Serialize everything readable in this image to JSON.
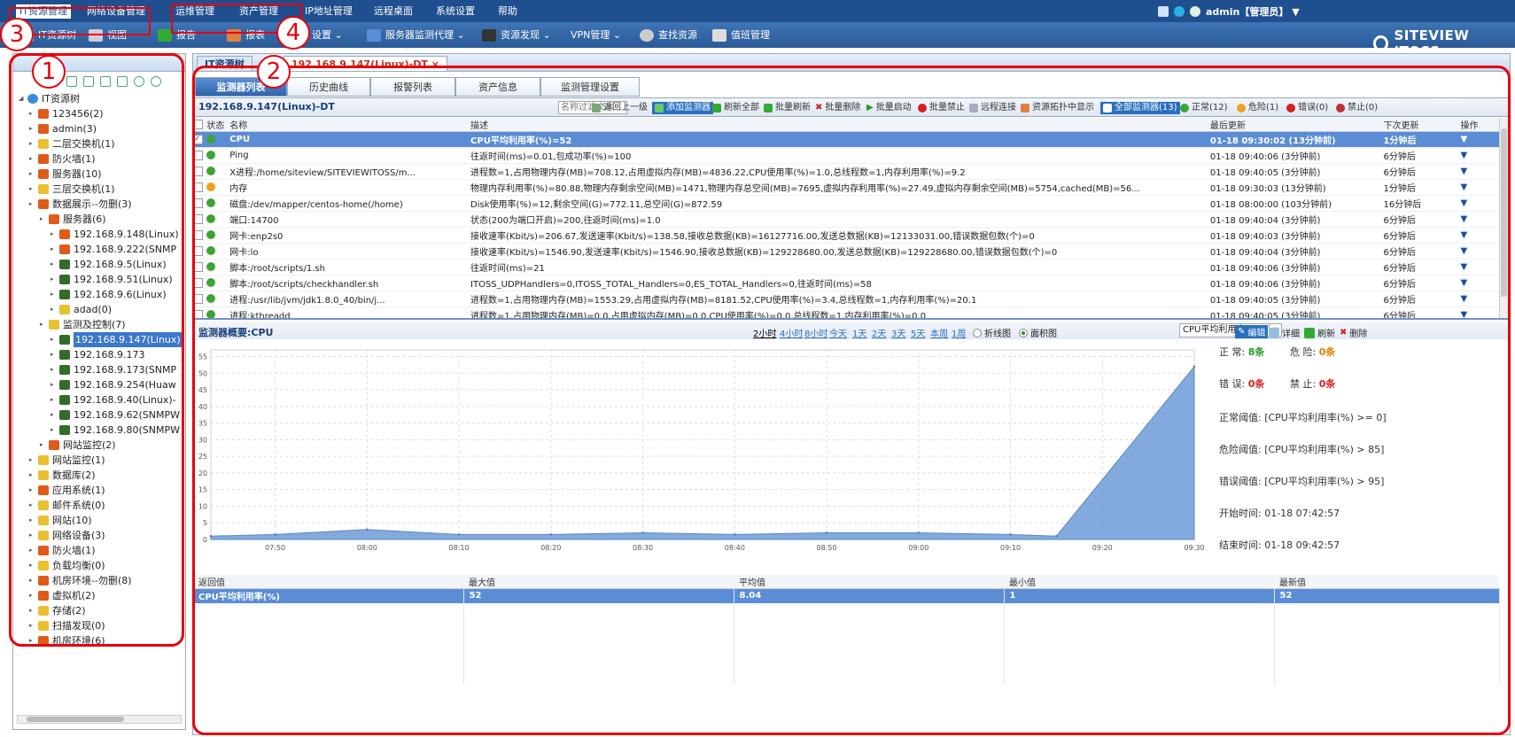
{
  "top_menu": {
    "items": [
      "IT资源管理",
      "网络设备管理",
      "运维管理",
      "资产管理",
      "IP地址管理",
      "远程桌面",
      "系统设置",
      "帮助"
    ]
  },
  "user": {
    "label": "admin【管理员】 ▼"
  },
  "brand": {
    "name": "SITEVIEW ITOSS"
  },
  "toolbar": {
    "items": [
      "IT资源树",
      "视图",
      "报告",
      "报表",
      "设置 ⌄",
      "服务器监测代理 ⌄",
      "资源发现 ⌄",
      "VPN管理 ⌄",
      "查找资源",
      "值班管理"
    ]
  },
  "tree": {
    "root": "IT资源树",
    "nodes": [
      {
        "label": "123456(2)",
        "icon": "red-folder-icon",
        "indent": 1
      },
      {
        "label": "admin(3)",
        "icon": "red-folder-icon",
        "indent": 1
      },
      {
        "label": "二层交换机(1)",
        "icon": "yellow-folder-icon",
        "indent": 1
      },
      {
        "label": "防火墙(1)",
        "icon": "red-folder-icon",
        "indent": 1
      },
      {
        "label": "服务器(10)",
        "icon": "red-folder-icon",
        "indent": 1
      },
      {
        "label": "三层交换机(1)",
        "icon": "yellow-folder-icon",
        "indent": 1
      },
      {
        "label": "数据展示--勿删(3)",
        "icon": "red-folder-icon",
        "indent": 1
      },
      {
        "label": "服务器(6)",
        "icon": "red-folder-icon",
        "indent": 2
      },
      {
        "label": "192.168.9.148(Linux)",
        "icon": "red-server-icon",
        "indent": 3
      },
      {
        "label": "192.168.9.222(SNMP",
        "icon": "red-server-icon",
        "indent": 3
      },
      {
        "label": "192.168.9.5(Linux)",
        "icon": "server-icon",
        "indent": 3
      },
      {
        "label": "192.168.9.51(Linux)",
        "icon": "server-icon",
        "indent": 3
      },
      {
        "label": "192.168.9.6(Linux)",
        "icon": "server-icon",
        "indent": 3
      },
      {
        "label": "adad(0)",
        "icon": "yellow-folder-icon",
        "indent": 3
      },
      {
        "label": "监测及控制(7)",
        "icon": "yellow-folder-icon",
        "indent": 2
      },
      {
        "label": "192.168.9.147(Linux)",
        "icon": "server-icon",
        "indent": 3,
        "selected": true
      },
      {
        "label": "192.168.9.173",
        "icon": "server-icon",
        "indent": 3
      },
      {
        "label": "192.168.9.173(SNMP",
        "icon": "server-icon",
        "indent": 3
      },
      {
        "label": "192.168.9.254(Huaw",
        "icon": "server-icon",
        "indent": 3
      },
      {
        "label": "192.168.9.40(Linux)-",
        "icon": "server-icon",
        "indent": 3
      },
      {
        "label": "192.168.9.62(SNMPW",
        "icon": "server-icon",
        "indent": 3
      },
      {
        "label": "192.168.9.80(SNMPW",
        "icon": "server-icon",
        "indent": 3
      },
      {
        "label": "网站监控(2)",
        "icon": "red-folder-icon",
        "indent": 2
      },
      {
        "label": "网站监控(1)",
        "icon": "yellow-folder-icon",
        "indent": 1
      },
      {
        "label": "数据库(2)",
        "icon": "yellow-folder-icon",
        "indent": 1
      },
      {
        "label": "应用系统(1)",
        "icon": "red-folder-icon",
        "indent": 1
      },
      {
        "label": "邮件系统(0)",
        "icon": "yellow-folder-icon",
        "indent": 1
      },
      {
        "label": "网站(10)",
        "icon": "yellow-folder-icon",
        "indent": 1
      },
      {
        "label": "网络设备(3)",
        "icon": "yellow-folder-icon",
        "indent": 1
      },
      {
        "label": "防火墙(1)",
        "icon": "red-folder-icon",
        "indent": 1
      },
      {
        "label": "负载均衡(0)",
        "icon": "yellow-folder-icon",
        "indent": 1
      },
      {
        "label": "机房环境--勿删(8)",
        "icon": "red-folder-icon",
        "indent": 1
      },
      {
        "label": "虚拟机(2)",
        "icon": "red-folder-icon",
        "indent": 1
      },
      {
        "label": "存储(2)",
        "icon": "yellow-folder-icon",
        "indent": 1
      },
      {
        "label": "扫描发现(0)",
        "icon": "yellow-folder-icon",
        "indent": 1
      },
      {
        "label": "机房环境(6)",
        "icon": "red-folder-icon",
        "indent": 1
      }
    ]
  },
  "panel_tabs": [
    "IT资源树",
    "192.168.9.147(Linux)-DT ×"
  ],
  "sub_tabs": [
    "监测器列表",
    "历史曲线",
    "报警列表",
    "资产信息",
    "监测管理设置"
  ],
  "object_title": "192.168.9.147(Linux)-DT",
  "filter": {
    "placeholder": "名称过滤文本"
  },
  "actions": [
    "返回上一级",
    "添加监测器",
    "刷新全部",
    "批量刷新",
    "批量删除",
    "批量启动",
    "批量禁止",
    "远程连接",
    "资源拓扑中显示",
    "全部监测器(13)",
    "正常(12)",
    "危险(1)",
    "错误(0)",
    "禁止(0)"
  ],
  "monitors": {
    "headers": [
      "状态",
      "名称",
      "描述",
      "最后更新",
      "下次更新",
      "操作"
    ],
    "rows": [
      {
        "status": "ok",
        "checked": true,
        "selected": true,
        "name": "CPU",
        "desc": "CPU平均利用率(%)=52",
        "last": "01-18 09:30:02 (13分钟前)",
        "next": "1分钟后"
      },
      {
        "status": "ok",
        "name": "Ping",
        "desc": "往返时间(ms)=0.01,包成功率(%)=100",
        "last": "01-18 09:40:06 (3分钟前)",
        "next": "6分钟后"
      },
      {
        "status": "ok",
        "name": "X进程:/home/siteview/SITEVIEWITOSS/m...",
        "desc": "进程数=1,占用物理内存(MB)=708.12,占用虚拟内存(MB)=4836.22,CPU使用率(%)=1.0,总线程数=1,内存利用率(%)=9.2",
        "last": "01-18 09:40:05 (3分钟前)",
        "next": "6分钟后"
      },
      {
        "status": "warn",
        "name": "内存",
        "desc": "物理内存利用率(%)=80.88,物理内存剩余空间(MB)=1471,物理内存总空间(MB)=7695,虚拟内存利用率(%)=27.49,虚拟内存剩余空间(MB)=5754,cached(MB)=56...",
        "last": "01-18 09:30:03 (13分钟前)",
        "next": "1分钟后"
      },
      {
        "status": "ok",
        "name": "磁盘:/dev/mapper/centos-home(/home)",
        "desc": "Disk使用率(%)=12,剩余空间(G)=772.11,总空间(G)=872.59",
        "last": "01-18 08:00:00 (103分钟前)",
        "next": "16分钟后"
      },
      {
        "status": "ok",
        "name": "端口:14700",
        "desc": "状态(200为端口开启)=200,往返时间(ms)=1.0",
        "last": "01-18 09:40:04 (3分钟前)",
        "next": "6分钟后"
      },
      {
        "status": "ok",
        "name": "网卡:enp2s0",
        "desc": "接收速率(Kbit/s)=206.67,发送速率(Kbit/s)=138.58,接收总数据(KB)=16127716.00,发送总数据(KB)=12133031.00,错误数据包数(个)=0",
        "last": "01-18 09:40:03 (3分钟前)",
        "next": "6分钟后"
      },
      {
        "status": "ok",
        "name": "网卡:lo",
        "desc": "接收速率(Kbit/s)=1546.90,发送速率(Kbit/s)=1546.90,接收总数据(KB)=129228680.00,发送总数据(KB)=129228680.00,错误数据包数(个)=0",
        "last": "01-18 09:40:04 (3分钟前)",
        "next": "6分钟后"
      },
      {
        "status": "ok",
        "name": "脚本:/root/scripts/1.sh",
        "desc": "往返时间(ms)=21",
        "last": "01-18 09:40:06 (3分钟前)",
        "next": "6分钟后"
      },
      {
        "status": "ok",
        "name": "脚本:/root/scripts/checkhandler.sh",
        "desc": "ITOSS_UDPHandlers=0,ITOSS_TOTAL_Handlers=0,ES_TOTAL_Handlers=0,往返时间(ms)=58",
        "last": "01-18 09:40:06 (3分钟前)",
        "next": "6分钟后"
      },
      {
        "status": "ok",
        "name": "进程:/usr/lib/jvm/jdk1.8.0_40/bin/j...",
        "desc": "进程数=1,占用物理内存(MB)=1553.29,占用虚拟内存(MB)=8181.52,CPU使用率(%)=3.4,总线程数=1,内存利用率(%)=20.1",
        "last": "01-18 09:40:05 (3分钟前)",
        "next": "6分钟后"
      },
      {
        "status": "ok",
        "name": "进程:kthreadd",
        "desc": "进程数=1,占用物理内存(MB)=0.0,占用虚拟内存(MB)=0.0,CPU使用率(%)=0.0,总线程数=1,内存利用率(%)=0.0",
        "last": "01-18 09:40:05 (3分钟前)",
        "next": "6分钟后"
      }
    ]
  },
  "summary": {
    "title": "监测器概要:CPU",
    "ranges": [
      "2小时",
      "4小时",
      "8小时",
      "今天",
      "1天",
      "2天",
      "3天",
      "5天",
      "本周",
      "1周"
    ],
    "chart_types": [
      "折线图",
      "面积图"
    ],
    "metric": "CPU平均利用率(%)",
    "buttons": [
      "编辑",
      "详细",
      "刷新",
      "删除"
    ]
  },
  "info": {
    "normal_label": "正    常:",
    "normal_value": "8条",
    "danger_label": "危    险:",
    "danger_value": "0条",
    "error_label": "错    误:",
    "error_value": "0条",
    "disabled_label": "禁    止:",
    "disabled_value": "0条",
    "normal_threshold": "正常阈值:   [CPU平均利用率(%) >= 0]",
    "danger_threshold": "危险阈值:   [CPU平均利用率(%) > 85]",
    "error_threshold": "错误阈值:   [CPU平均利用率(%) > 95]",
    "start_time": "开始时间:   01-18 07:42:57",
    "end_time": "结束时间:   01-18 09:42:57"
  },
  "chart_data": {
    "type": "area",
    "title": "",
    "x": [
      "07:43",
      "07:50",
      "08:00",
      "08:10",
      "08:20",
      "08:30",
      "08:40",
      "08:50",
      "09:00",
      "09:10",
      "09:15",
      "09:30"
    ],
    "series": [
      {
        "name": "CPU平均利用率(%)",
        "values": [
          1,
          1.5,
          3,
          1.5,
          1.5,
          2,
          1.5,
          2,
          2,
          1.5,
          1,
          52
        ]
      }
    ],
    "x_ticks": [
      "07:50",
      "08:00",
      "08:10",
      "08:20",
      "08:30",
      "08:40",
      "08:50",
      "09:00",
      "09:10",
      "09:20",
      "09:30"
    ],
    "y_ticks": [
      0,
      5,
      10,
      15,
      20,
      25,
      30,
      35,
      40,
      45,
      50,
      55
    ],
    "ylim": [
      0,
      57
    ],
    "grid": true,
    "color": "#6d9bd6"
  },
  "stats": {
    "headers": [
      "返回值",
      "最大值",
      "平均值",
      "最小值",
      "最新值"
    ],
    "row": [
      "CPU平均利用率(%)",
      "52",
      "8.04",
      "1",
      "52"
    ]
  },
  "annotations": [
    "1",
    "2",
    "3",
    "4"
  ]
}
